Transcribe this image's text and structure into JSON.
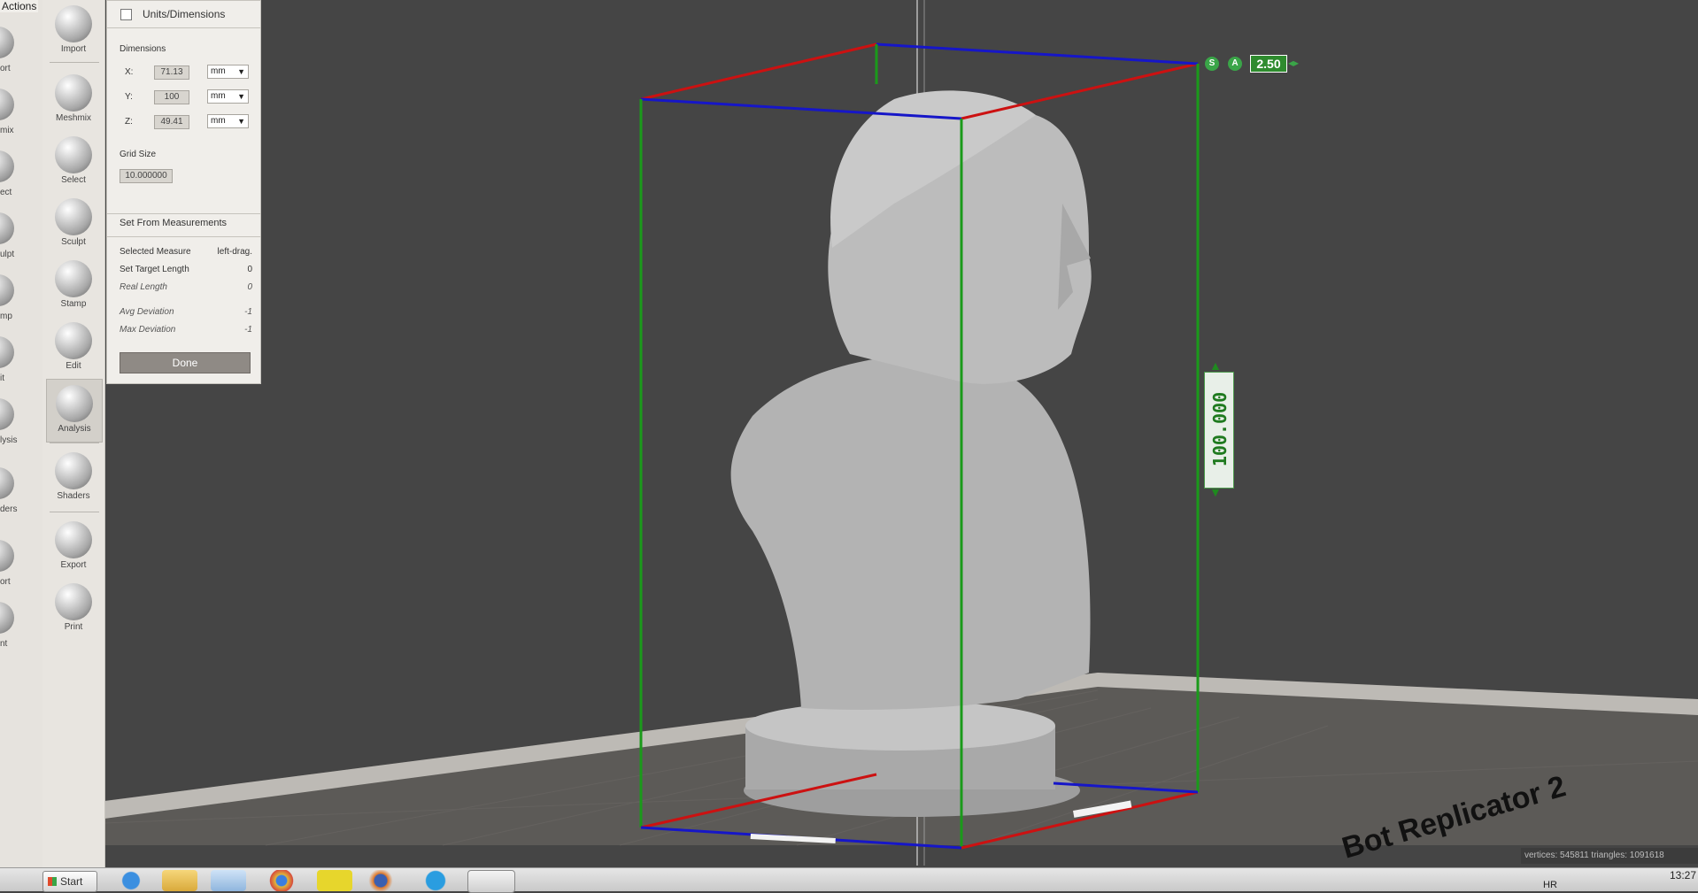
{
  "left_toolbar": {
    "header": "Actions",
    "items": [
      "ort",
      "mix",
      "ect",
      "ulpt",
      "mp",
      "it",
      "lysis",
      "ders",
      "ort",
      "nt"
    ]
  },
  "toolbar": {
    "items": [
      {
        "label": "Import",
        "icon": "plus-icon"
      },
      {
        "label": "Meshmix",
        "icon": "meshmix-icon"
      },
      {
        "label": "Select",
        "icon": "select-arrow-icon"
      },
      {
        "label": "Sculpt",
        "icon": "brush-icon"
      },
      {
        "label": "Stamp",
        "icon": "stamp-icon"
      },
      {
        "label": "Edit",
        "icon": "edit-icon"
      },
      {
        "label": "Analysis",
        "icon": "analysis-icon"
      },
      {
        "label": "Shaders",
        "icon": "shader-sphere-icon"
      },
      {
        "label": "Export",
        "icon": "export-icon"
      },
      {
        "label": "Print",
        "icon": "printer-icon"
      }
    ]
  },
  "panel": {
    "title": "Units/Dimensions",
    "dimensions_label": "Dimensions",
    "x_label": "X:",
    "x_value": "71.13",
    "y_label": "Y:",
    "y_value": "100",
    "z_label": "Z:",
    "z_value": "49.41",
    "unit": "mm",
    "grid_size_label": "Grid Size",
    "grid_size_value": "10.000000",
    "set_from_label": "Set From Measurements",
    "selected_measure_label": "Selected Measure",
    "selected_measure_value": "left-drag.",
    "set_target_length_label": "Set Target Length",
    "set_target_length_value": "0",
    "real_length_label": "Real Length",
    "real_length_value": "0",
    "avg_deviation_label": "Avg Deviation",
    "avg_deviation_value": "-1",
    "max_deviation_label": "Max Deviation",
    "max_deviation_value": "-1",
    "done_label": "Done"
  },
  "viewport": {
    "scale_badge": "2.50",
    "scale_s": "S",
    "scale_a": "A",
    "height_readout": "100.000",
    "printer_label": "Bot Replicator 2",
    "status": "vertices: 545811 triangles: 1091618"
  },
  "taskbar": {
    "start_label": "Start",
    "lang": "HR",
    "time": "13:27",
    "apps": [
      "ie-icon",
      "explorer-icon",
      "paint-icon",
      "chrome-icon",
      "fireworks-icon",
      "firefox-icon",
      "skype-icon",
      "meshmixer-icon"
    ]
  },
  "colors": {
    "bbox_red": "#cc1111",
    "bbox_blue": "#1616c8",
    "bbox_green": "#1a9a1a",
    "bg": "#454545"
  }
}
